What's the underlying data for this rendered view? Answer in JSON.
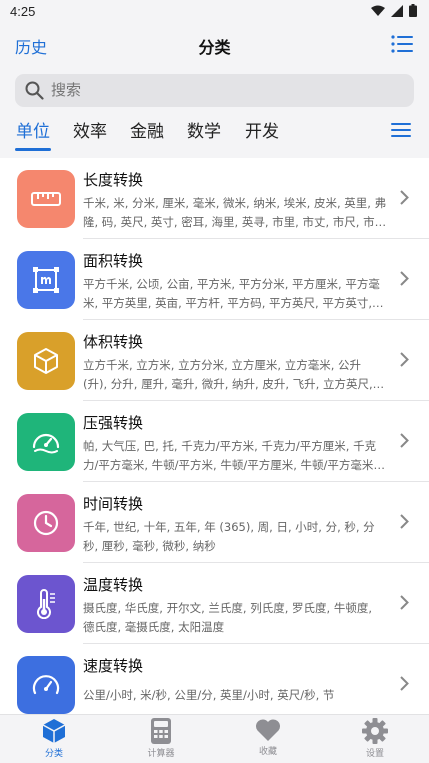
{
  "status": {
    "time": "4:25"
  },
  "header": {
    "history": "历史",
    "title": "分类"
  },
  "search": {
    "placeholder": "搜索"
  },
  "tabs": [
    {
      "label": "单位"
    },
    {
      "label": "效率"
    },
    {
      "label": "金融"
    },
    {
      "label": "数学"
    },
    {
      "label": "开发"
    }
  ],
  "items": [
    {
      "title": "长度转换",
      "desc": "千米, 米, 分米, 厘米, 毫米, 微米, 纳米, 埃米, 皮米, 英里, 弗隆, 码, 英尺, 英寸, 密耳, 海里, 英寻, 市里, 市丈, 市尺, 市寸, 市…",
      "color": "#f5876e",
      "icon": "ruler-icon"
    },
    {
      "title": "面积转换",
      "desc": "平方千米, 公顷, 公亩, 平方米, 平方分米, 平方厘米, 平方毫米, 平方英里, 英亩, 平方杆, 平方码, 平方英尺, 平方英寸, 顷, 亩,…",
      "color": "#4a77e8",
      "icon": "area-icon"
    },
    {
      "title": "体积转换",
      "desc": "立方千米, 立方米, 立方分米, 立方厘米, 立方毫米, 公升 (升), 分升, 厘升, 毫升, 微升, 纳升, 皮升, 飞升, 立方英尺, 立方英…",
      "color": "#d9a02a",
      "icon": "cube-icon"
    },
    {
      "title": "压强转换",
      "desc": "帕, 大气压, 巴, 托, 千克力/平方米, 千克力/平方厘米, 千克力/平方毫米, 牛顿/平方米, 牛顿/平方厘米, 牛顿/平方毫米, 工…",
      "color": "#1fb57a",
      "icon": "gauge-icon"
    },
    {
      "title": "时间转换",
      "desc": "千年, 世纪, 十年, 五年, 年 (365), 周, 日, 小时, 分, 秒, 分秒, 厘秒, 毫秒, 微秒, 纳秒",
      "color": "#d6669c",
      "icon": "clock-icon"
    },
    {
      "title": "温度转换",
      "desc": "摄氏度, 华氏度, 开尔文, 兰氏度, 列氏度, 罗氏度, 牛顿度, 德氏度, 毫摄氏度, 太阳温度",
      "color": "#6c55cf",
      "icon": "thermometer-icon"
    },
    {
      "title": "速度转换",
      "desc": "公里/小时, 米/秒, 公里/分, 英里/小时, 英尺/秒, 节",
      "color": "#3d6fe0",
      "icon": "speedometer-icon"
    }
  ],
  "nav": [
    {
      "label": "分类",
      "icon": "cube-icon"
    },
    {
      "label": "计算器",
      "icon": "calculator-icon"
    },
    {
      "label": "收藏",
      "icon": "heart-icon"
    },
    {
      "label": "设置",
      "icon": "gear-icon"
    }
  ],
  "colors": {
    "accent": "#1f6fd6",
    "background": "#f4f4f6"
  }
}
